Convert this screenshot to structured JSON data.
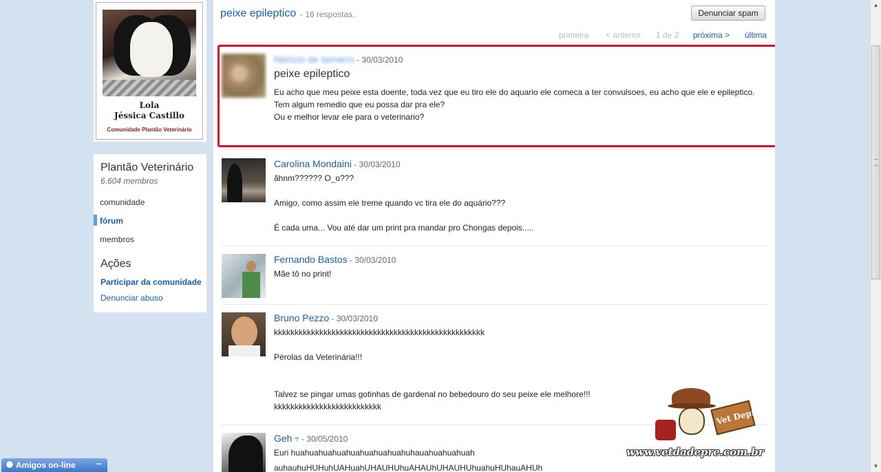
{
  "sidebar": {
    "profile": {
      "pet_name": "Lola",
      "owner_name": "Jéssica Castillo",
      "community_caption": "Comunidade Plantão Veterinário"
    },
    "community_name": "Plantão Veterinário",
    "members_count": "6.604 membros",
    "nav": {
      "comunidade": "comunidade",
      "forum": "fórum",
      "membros": "membros"
    },
    "actions_title": "Ações",
    "join_label": "Participar da comunidade",
    "report_abuse_label": "Denunciar abuso"
  },
  "topic": {
    "title": "peixe epileptico",
    "reply_count": "- 16 respostas.",
    "report_spam_label": "Denunciar spam"
  },
  "pagination": {
    "first": "primeira",
    "prev": "< anterior",
    "info": "1 de 2",
    "next": "próxima >",
    "last": "última"
  },
  "posts": [
    {
      "author": "fabrizio de tamarro",
      "date": "- 30/03/2010",
      "subject": "peixe epileptico",
      "lines": [
        "Eu acho que meu peixe esta doente, toda vez que eu tiro ele do aquario ele comeca a ter convulsoes, eu acho que ele e epileptico.",
        "Tem algum remedio que eu possa dar pra ele?",
        "Ou e melhor levar ele para o veterinario?"
      ]
    },
    {
      "author": "Carolina Mondaini",
      "date": "- 30/03/2010",
      "lines": [
        "ãhnm?????? O_o???",
        "Amigo, como assim ele treme quando vc tira ele do aquário???",
        "É cada uma... Vou até dar um print pra mandar pro Chongas depois....."
      ]
    },
    {
      "author": "Fernando Bastos",
      "date": "- 30/03/2010",
      "lines": [
        "Mãe tô no print!"
      ]
    },
    {
      "author": "Bruno Pezzo",
      "date": "- 30/03/2010",
      "lines": [
        "kkkkkkkkkkkkkkkkkkkkkkkkkkkkkkkkkkkkkkkkkkkkkkkkkkk",
        "Pérolas da Veterinária!!!",
        "Talvez se pingar umas gotinhas de gardenal no bebedouro do seu peixe ele melhore!!!",
        "kkkkkkkkkkkkkkkkkkkkkkkkkk"
      ]
    },
    {
      "author": "Geh",
      "mod_icon": "⥾",
      "date": "- 30/05/2010",
      "lines": [
        "Euri huahuahuahuahuahuahuahuahuhauahuahuahuah",
        "auhauhuHUHuhUAHuahUHAUHUhuAHAUhUHAUHUhuahuHUhauAHUh"
      ]
    }
  ],
  "watermark": {
    "sign_text": "Vet Depre",
    "url": "www.vetdadepre.com.br"
  },
  "chat": {
    "label": "Amigos on-line",
    "minimize": "–"
  },
  "icons": {
    "scroll_up": "▲",
    "scroll_down": "▼"
  },
  "colors": {
    "background": "#d4e1f1",
    "link": "#1a5fa8",
    "highlight_frame": "#d8102a",
    "chat_bar": "#3f76c8"
  }
}
